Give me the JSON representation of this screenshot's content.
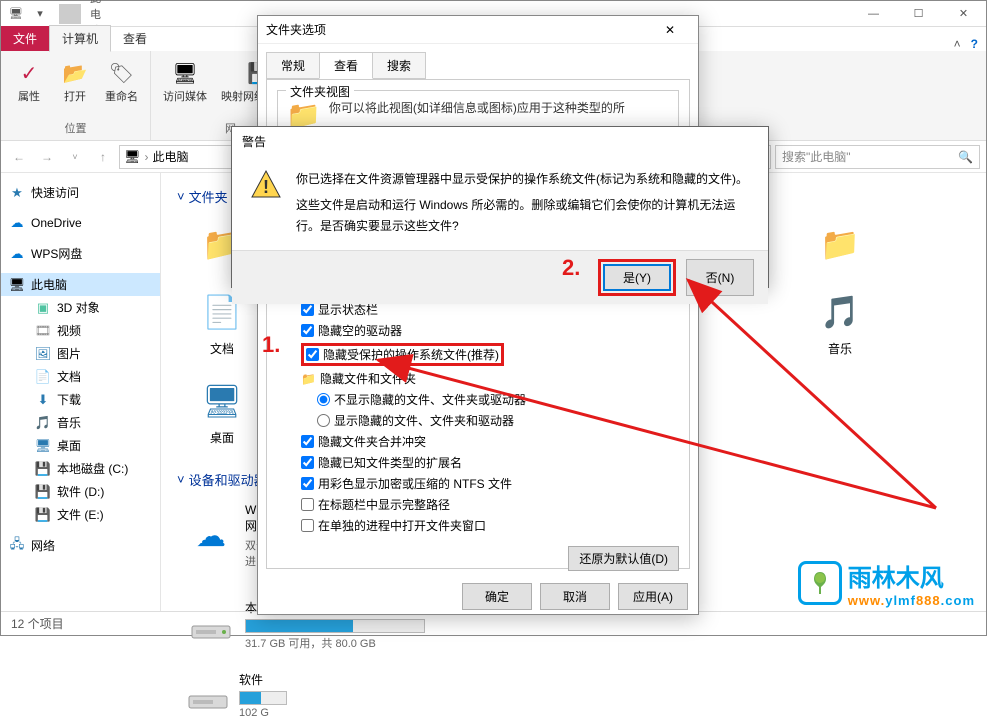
{
  "window": {
    "title": "此电脑"
  },
  "ribbon": {
    "file_tab": "文件",
    "tabs": [
      "计算机",
      "查看"
    ],
    "buttons": {
      "properties": "属性",
      "open": "打开",
      "rename": "重命名",
      "media": "访问媒体",
      "map_drive": "映射网络驱动器",
      "more": "▾"
    },
    "groups": {
      "location": "位置",
      "network": "网"
    }
  },
  "nav": {
    "breadcrumb": "此电脑",
    "search_placeholder": "搜索\"此电脑\""
  },
  "sidebar": {
    "quick_access": "快速访问",
    "onedrive": "OneDrive",
    "wps": "WPS网盘",
    "this_pc": "此电脑",
    "items": [
      "3D 对象",
      "视频",
      "图片",
      "文档",
      "下载",
      "音乐",
      "桌面",
      "本地磁盘 (C:)",
      "软件 (D:)",
      "文件 (E:)"
    ],
    "network": "网络"
  },
  "main": {
    "section_folders": "文件夹",
    "section_drives": "设备和驱动器",
    "folders": {
      "docs": "文档",
      "desktop": "桌面",
      "music": "音乐"
    },
    "wps_cloud": {
      "name": "WPS网",
      "sub": "双击进"
    },
    "software": {
      "name": "软件",
      "sub": "102 G"
    },
    "drive_c": {
      "name": "本地磁盘 (C:)",
      "status": "31.7 GB 可用，共 80.0 GB",
      "used_fraction": 0.6
    }
  },
  "statusbar": {
    "count": "12 个项目"
  },
  "folder_options": {
    "title": "文件夹选项",
    "tabs": {
      "general": "常规",
      "view": "查看",
      "search": "搜索"
    },
    "view_group": {
      "title": "文件夹视图",
      "text": "你可以将此视图(如详细信息或图标)应用于这种类型的所"
    },
    "advanced": {
      "show_statusbar": "显示状态栏",
      "hide_empty_drives": "隐藏空的驱动器",
      "hide_protected_os": "隐藏受保护的操作系统文件(推荐)",
      "hidden_files_folder": "隐藏文件和文件夹",
      "dont_show_hidden": "不显示隐藏的文件、文件夹或驱动器",
      "show_hidden": "显示隐藏的文件、文件夹和驱动器",
      "hide_merge_conflict": "隐藏文件夹合并冲突",
      "hide_known_ext": "隐藏已知文件类型的扩展名",
      "color_ntfs": "用彩色显示加密或压缩的 NTFS 文件",
      "full_path_title": "在标题栏中显示完整路径",
      "separate_process": "在单独的进程中打开文件夹窗口"
    },
    "restore_defaults": "还原为默认值(D)",
    "ok": "确定",
    "cancel": "取消",
    "apply": "应用(A)"
  },
  "warning": {
    "title": "警告",
    "line1": "你已选择在文件资源管理器中显示受保护的操作系统文件(标记为系统和隐藏的文件)。",
    "line2": "这些文件是启动和运行 Windows 所必需的。删除或编辑它们会使你的计算机无法运行。是否确实要显示这些文件?",
    "yes": "是(Y)",
    "no": "否(N)"
  },
  "annotations": {
    "one": "1.",
    "two": "2."
  },
  "watermark": {
    "name": "雨林木风",
    "url": "www.ylmf888.com"
  }
}
